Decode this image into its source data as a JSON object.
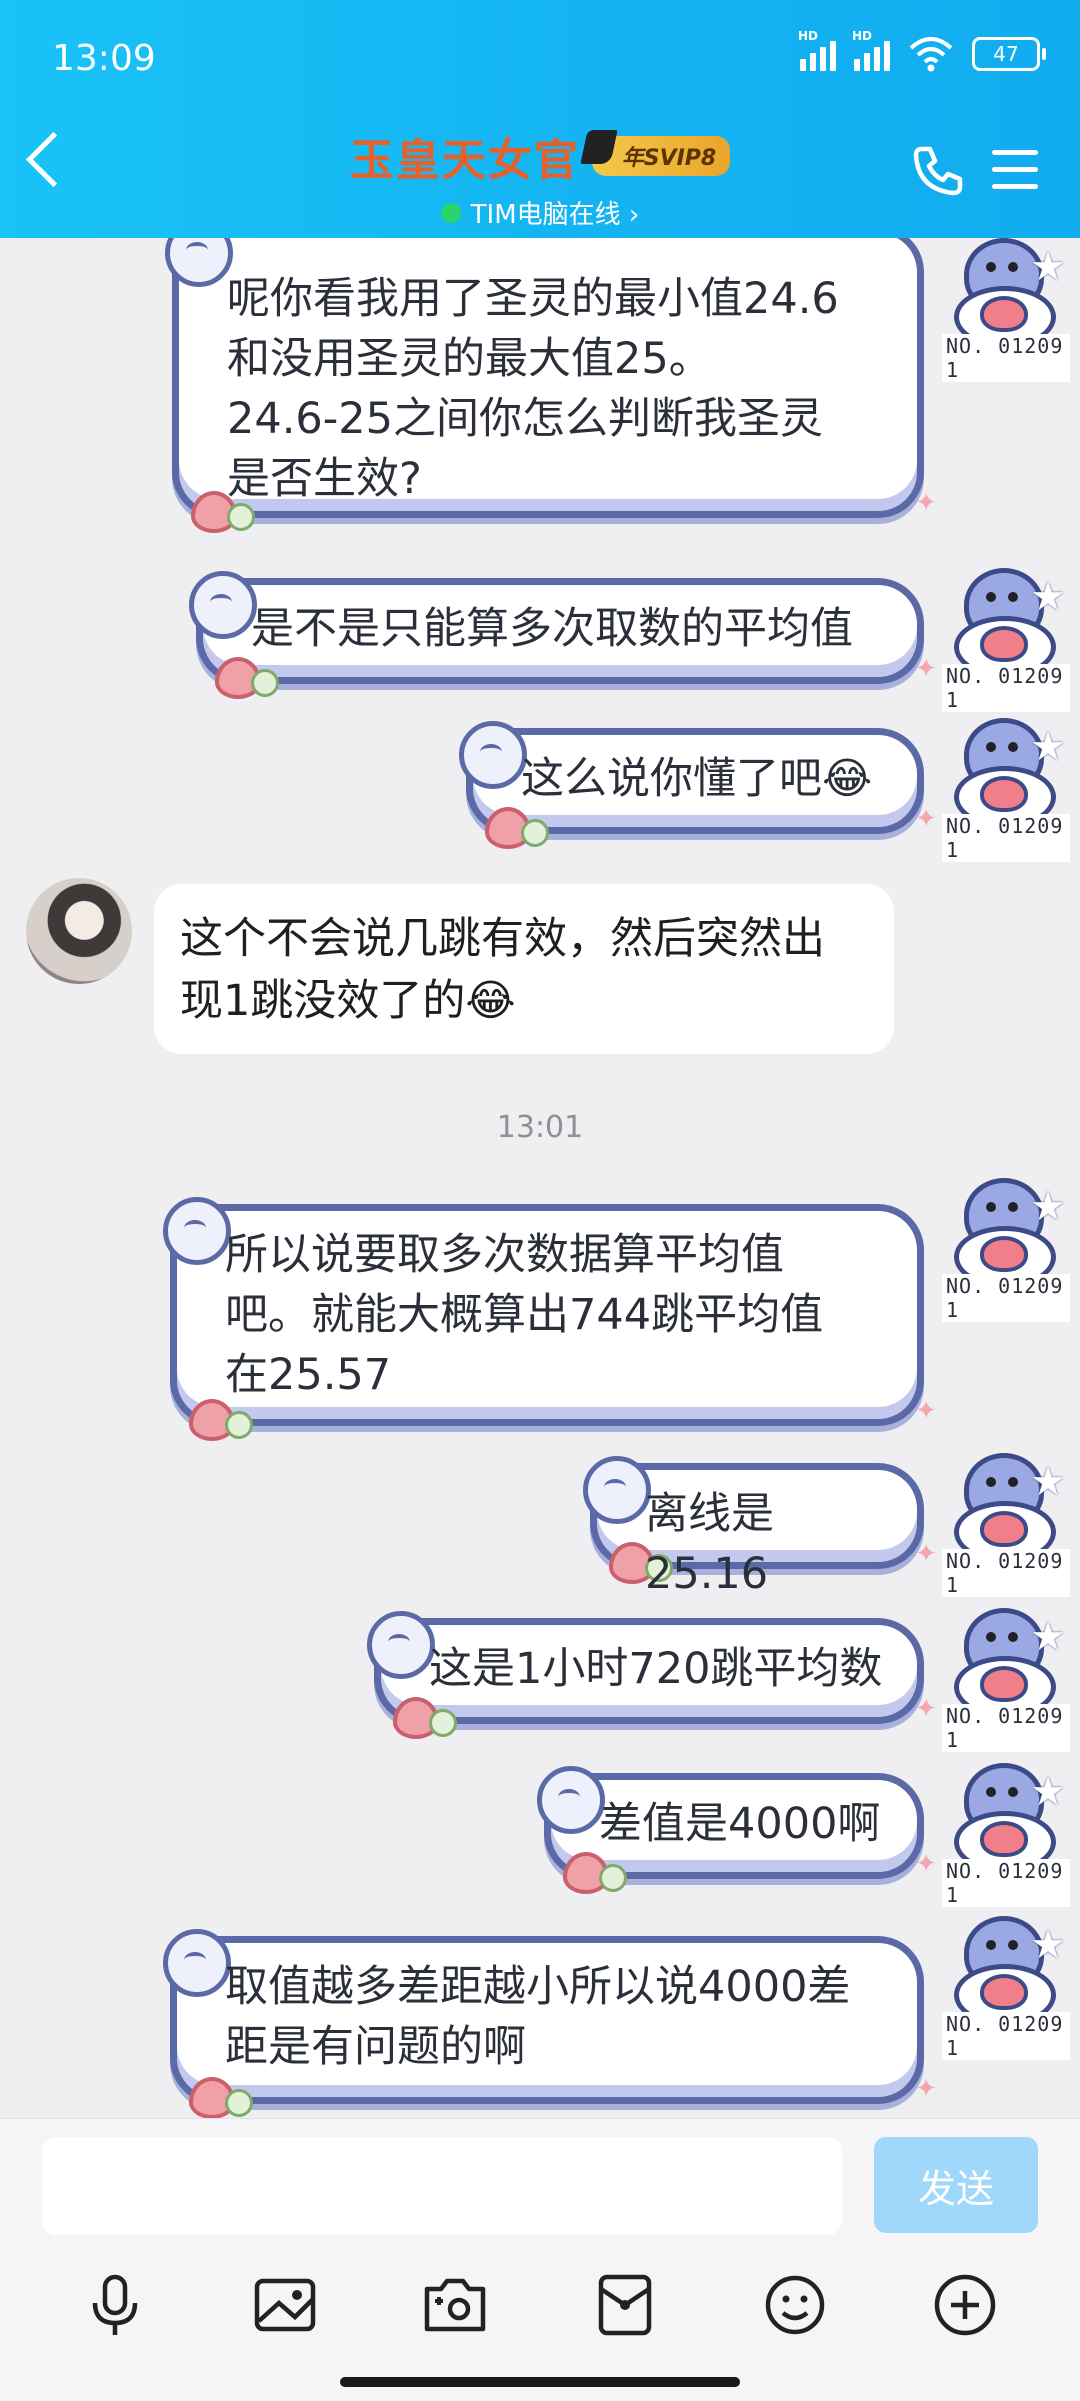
{
  "status_bar": {
    "time": "13:09",
    "battery": "47",
    "hd1": "HD",
    "hd2": "HD"
  },
  "header": {
    "title": "玉皇天女官",
    "svip_badge": "年SVIP8",
    "online_status": "TIM电脑在线 ›",
    "accent": "#14b4f2",
    "title_color": "#e4612c"
  },
  "self_avatar": {
    "badge_number": "NO. 01209 1"
  },
  "messages": [
    {
      "side": "right",
      "text": "呢你看我用了圣灵的最小值24.6\n和没用圣灵的最大值25。\n24.6-25之间你怎么判断我圣灵\n是否生效?"
    },
    {
      "side": "right",
      "text": "是不是只能算多次取数的平均值"
    },
    {
      "side": "right",
      "text": "这么说你懂了吧😂"
    },
    {
      "side": "left",
      "text": "这个不会说几跳有效，然后突然出\n现1跳没效了的😂"
    },
    {
      "side": "right",
      "text": "所以说要取多次数据算平均值\n吧。就能大概算出744跳平均值\n在25.57"
    },
    {
      "side": "right",
      "text": "离线是25.16"
    },
    {
      "side": "right",
      "text": "这是1小时720跳平均数"
    },
    {
      "side": "right",
      "text": "差值是4000啊"
    },
    {
      "side": "right",
      "text": "取值越多差距越小所以说4000差\n距是有问题的啊"
    }
  ],
  "timestamp": "13:01",
  "input": {
    "value": "",
    "placeholder": "",
    "send_label": "发送"
  },
  "toolbar_icons": [
    "microphone-icon",
    "image-icon",
    "camera-icon",
    "red-packet-icon",
    "emoji-icon",
    "plus-icon"
  ]
}
